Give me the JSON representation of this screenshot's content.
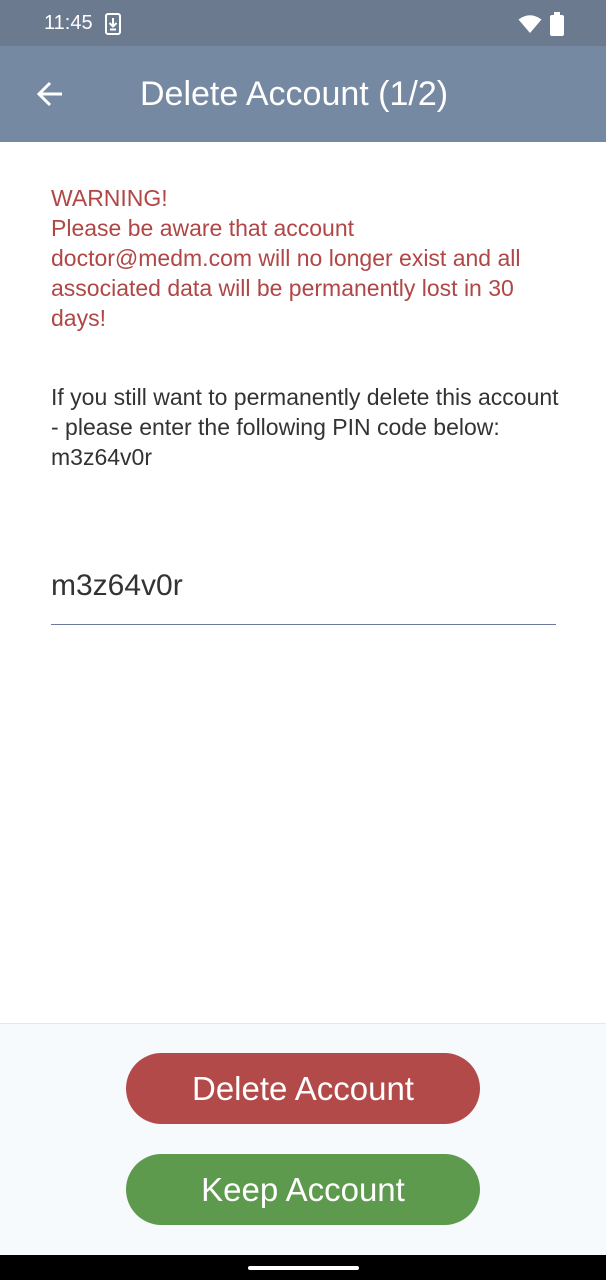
{
  "status_bar": {
    "time": "11:45",
    "icons": [
      "download-icon",
      "wifi-icon",
      "battery-icon"
    ]
  },
  "app_bar": {
    "title": "Delete Account (1/2)",
    "back_icon": "arrow-left-icon"
  },
  "content": {
    "warning_title": "WARNING!",
    "warning_body": "Please be aware that account doctor@medm.com will no longer exist and all associated data will be permanently lost in 30 days!",
    "instructions": "If you still want to permanently delete this account - please enter the following PIN code below: m3z64v0r"
  },
  "pin_input": {
    "value": "m3z64v0r"
  },
  "buttons": {
    "delete_label": "Delete Account",
    "keep_label": "Keep Account"
  },
  "colors": {
    "status_bar": "#6b7a8f",
    "app_bar": "#7689a2",
    "warning_text": "#b04646",
    "delete_button": "#b34a4a",
    "keep_button": "#5d9a4d"
  }
}
